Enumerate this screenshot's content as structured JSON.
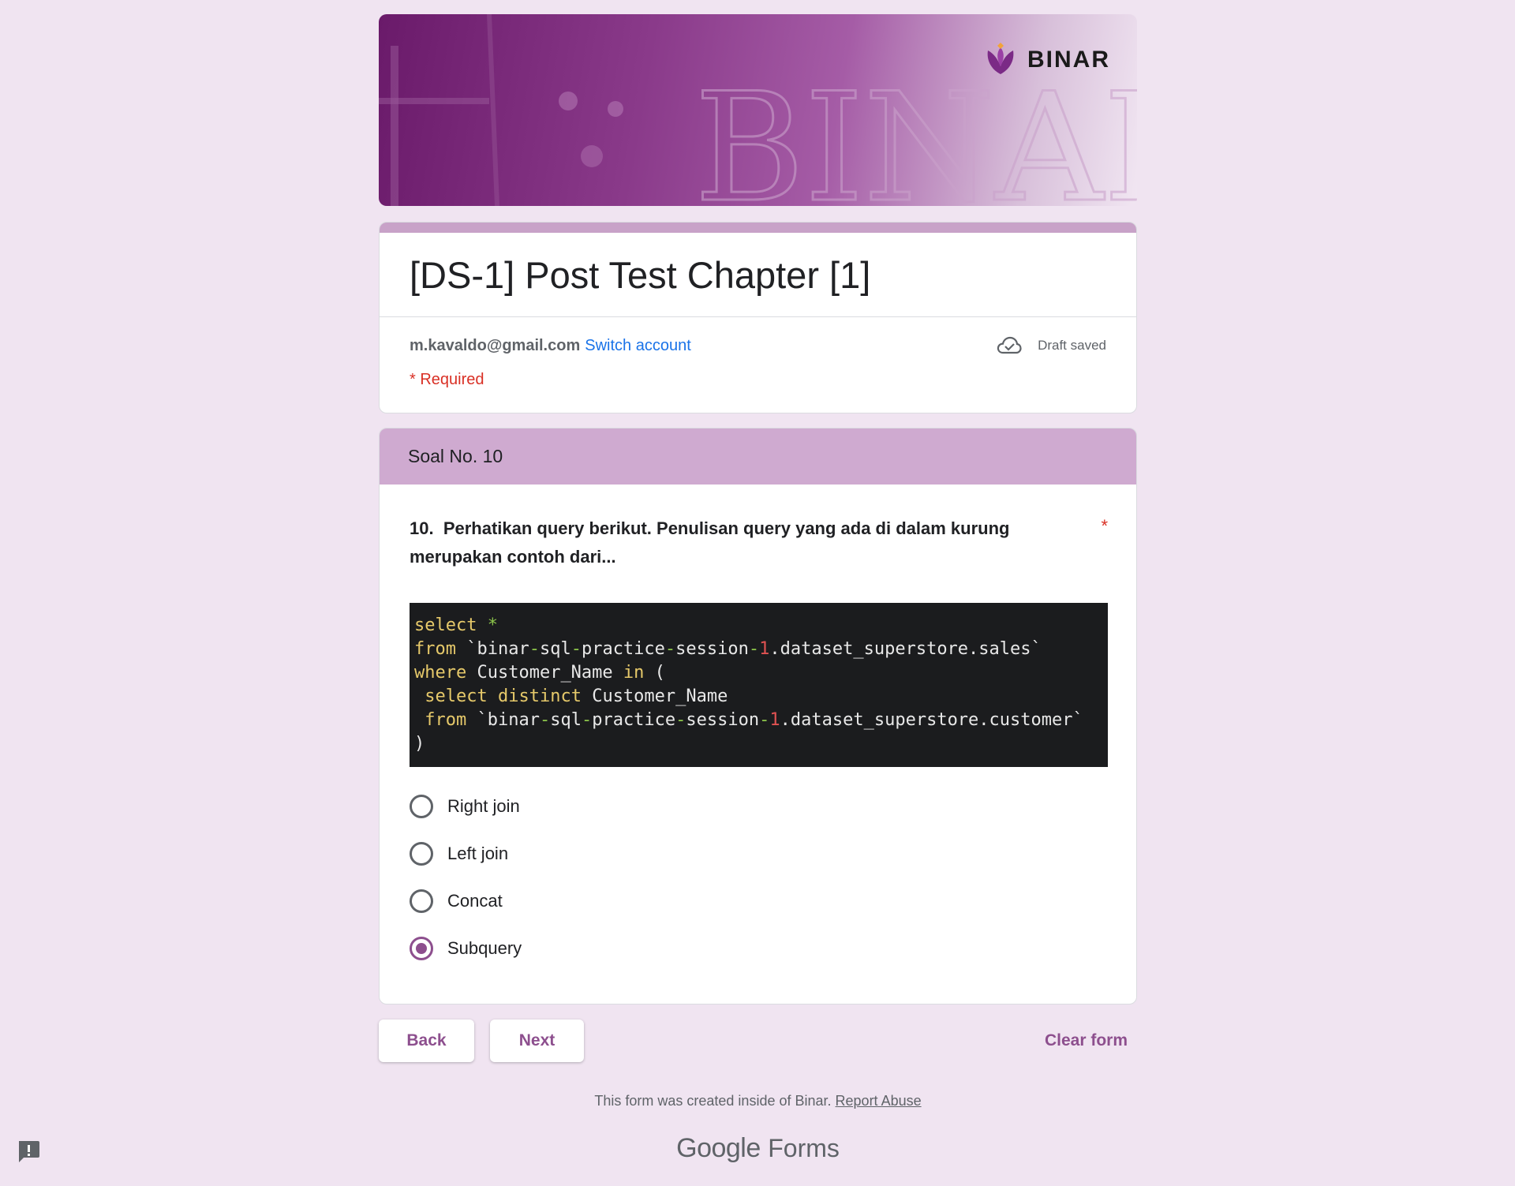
{
  "banner": {
    "logo_text": "BINAR",
    "bg_text": "BINAR"
  },
  "form": {
    "title": "[DS-1] Post Test Chapter [1]",
    "account_email": "m.kavaldo@gmail.com",
    "switch_account": "Switch account",
    "draft_status": "Draft saved",
    "required_note": "* Required"
  },
  "section": {
    "title": "Soal No. 10"
  },
  "question": {
    "number": "10.",
    "text": "Perhatikan query berikut. Penulisan query yang ada di dalam kurung merupakan contoh dari...",
    "required_mark": "*",
    "code_lines": [
      "select *",
      "from `binar-sql-practice-session-1.dataset_superstore.sales`",
      "where Customer_Name in (",
      " select distinct Customer_Name",
      " from `binar-sql-practice-session-1.dataset_superstore.customer`",
      ")"
    ],
    "options": [
      {
        "label": "Right join",
        "checked": false
      },
      {
        "label": "Left join",
        "checked": false
      },
      {
        "label": "Concat",
        "checked": false
      },
      {
        "label": "Subquery",
        "checked": true
      }
    ]
  },
  "nav": {
    "back_label": "Back",
    "next_label": "Next",
    "clear_label": "Clear form"
  },
  "footer": {
    "note": "This form was created inside of Binar.",
    "report_link": "Report Abuse",
    "brand_google": "Google",
    "brand_forms": "Forms"
  },
  "colors": {
    "page_bg": "#f0e4f1",
    "accent": "#8d4f8e",
    "section_header": "#cfaad0",
    "required": "#d93025",
    "link": "#1a73e8"
  },
  "icons": {
    "cloud": "cloud-check-icon",
    "report": "report-issue-icon",
    "logo": "binar-logo-icon"
  }
}
